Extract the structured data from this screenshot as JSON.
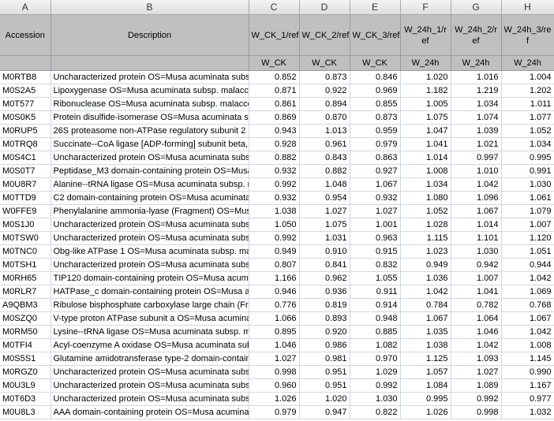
{
  "columns": [
    "A",
    "B",
    "C",
    "D",
    "E",
    "F",
    "G",
    "H"
  ],
  "headers": {
    "row1": [
      "Accession",
      "Description",
      "W_CK_1/ref",
      "W_CK_2/ref",
      "W_CK_3/ref",
      "W_24h_1/ref",
      "W_24h_2/ref",
      "W_24h_3/ref"
    ],
    "row2": [
      "",
      "",
      "W_CK",
      "W_CK",
      "W_CK",
      "W_24h",
      "W_24h",
      "W_24h"
    ]
  },
  "rows": [
    [
      "M0RTB8",
      "Uncharacterized protein OS=Musa acuminata subsp",
      "0.852",
      "0.873",
      "0.846",
      "1.020",
      "1.016",
      "1.004"
    ],
    [
      "M0S2A5",
      "Lipoxygenase OS=Musa acuminata subsp. malaccer",
      "0.871",
      "0.922",
      "0.969",
      "1.182",
      "1.219",
      "1.202"
    ],
    [
      "M0T577",
      "Ribonuclease OS=Musa acuminata subsp. malaccen",
      "0.861",
      "0.894",
      "0.855",
      "1.005",
      "1.034",
      "1.011"
    ],
    [
      "M0S0K5",
      "Protein disulfide-isomerase OS=Musa acuminata sub",
      "0.869",
      "0.870",
      "0.873",
      "1.075",
      "1.074",
      "1.077"
    ],
    [
      "M0RUP5",
      "26S proteasome non-ATPase regulatory subunit 2 h",
      "0.943",
      "1.013",
      "0.959",
      "1.047",
      "1.039",
      "1.052"
    ],
    [
      "M0TRQ8",
      "Succinate--CoA ligase [ADP-forming] subunit beta, r",
      "0.928",
      "0.961",
      "0.979",
      "1.041",
      "1.021",
      "1.034"
    ],
    [
      "M0S4C1",
      "Uncharacterized protein OS=Musa acuminata subsp",
      "0.882",
      "0.843",
      "0.863",
      "1.014",
      "0.997",
      "0.995"
    ],
    [
      "M0S0T7",
      "Peptidase_M3 domain-containing protein OS=Musa",
      "0.932",
      "0.882",
      "0.927",
      "1.008",
      "1.010",
      "0.991"
    ],
    [
      "M0U8R7",
      "Alanine--tRNA ligase OS=Musa acuminata subsp. ma",
      "0.992",
      "1.048",
      "1.067",
      "1.034",
      "1.042",
      "1.030"
    ],
    [
      "M0TTD9",
      "C2 domain-containing protein OS=Musa acuminata s",
      "0.932",
      "0.954",
      "0.932",
      "1.080",
      "1.096",
      "1.061"
    ],
    [
      "W0FFE9",
      "Phenylalanine ammonia-lyase (Fragment) OS=Musa",
      "1.038",
      "1.027",
      "1.027",
      "1.052",
      "1.067",
      "1.079"
    ],
    [
      "M0S1J0",
      "Uncharacterized protein OS=Musa acuminata subsp",
      "1.050",
      "1.075",
      "1.001",
      "1.028",
      "1.014",
      "1.007"
    ],
    [
      "M0TSW0",
      "Uncharacterized protein OS=Musa acuminata subsp",
      "0.992",
      "1.031",
      "0.963",
      "1.115",
      "1.101",
      "1.120"
    ],
    [
      "M0TNC0",
      "Obg-like ATPase 1 OS=Musa acuminata subsp. mala",
      "0.949",
      "0.910",
      "0.915",
      "1.023",
      "1.030",
      "1.051"
    ],
    [
      "M0TSH1",
      "Uncharacterized protein OS=Musa acuminata subsp",
      "0.807",
      "0.841",
      "0.832",
      "0.949",
      "0.942",
      "0.944"
    ],
    [
      "M0RH65",
      "TIP120 domain-containing protein OS=Musa acumin",
      "1.166",
      "0.962",
      "1.055",
      "1.036",
      "1.007",
      "1.042"
    ],
    [
      "M0RLR7",
      "HATPase_c domain-containing protein OS=Musa acu",
      "0.946",
      "0.936",
      "0.911",
      "1.042",
      "1.041",
      "1.069"
    ],
    [
      "A9QBM3",
      "Ribulose bisphosphate carboxylase large chain (Fra",
      "0.776",
      "0.819",
      "0.914",
      "0.784",
      "0.782",
      "0.768"
    ],
    [
      "M0SZQ0",
      "V-type proton ATPase subunit a OS=Musa acuminat",
      "1.066",
      "0.893",
      "0.948",
      "1.067",
      "1.064",
      "1.067"
    ],
    [
      "M0RM50",
      "Lysine--tRNA ligase OS=Musa acuminata subsp. ma",
      "0.895",
      "0.920",
      "0.885",
      "1.035",
      "1.046",
      "1.042"
    ],
    [
      "M0TFI4",
      "Acyl-coenzyme A oxidase OS=Musa acuminata subs",
      "1.046",
      "0.986",
      "1.082",
      "1.038",
      "1.042",
      "1.008"
    ],
    [
      "M0S5S1",
      "Glutamine amidotransferase type-2 domain-containi",
      "1.027",
      "0.981",
      "0.970",
      "1.125",
      "1.093",
      "1.145"
    ],
    [
      "M0RGZ0",
      "Uncharacterized protein OS=Musa acuminata subsp",
      "0.998",
      "0.951",
      "1.029",
      "1.057",
      "1.027",
      "0.990"
    ],
    [
      "M0U3L9",
      "Uncharacterized protein OS=Musa acuminata subsp",
      "0.960",
      "0.951",
      "0.992",
      "1.084",
      "1.089",
      "1.167"
    ],
    [
      "M0T6D3",
      "Uncharacterized protein OS=Musa acuminata subsp",
      "1.026",
      "1.020",
      "1.030",
      "0.995",
      "0.992",
      "0.977"
    ],
    [
      "M0U8L3",
      "AAA domain-containing protein OS=Musa acuminata",
      "0.979",
      "0.947",
      "0.822",
      "1.026",
      "0.998",
      "1.032"
    ]
  ]
}
